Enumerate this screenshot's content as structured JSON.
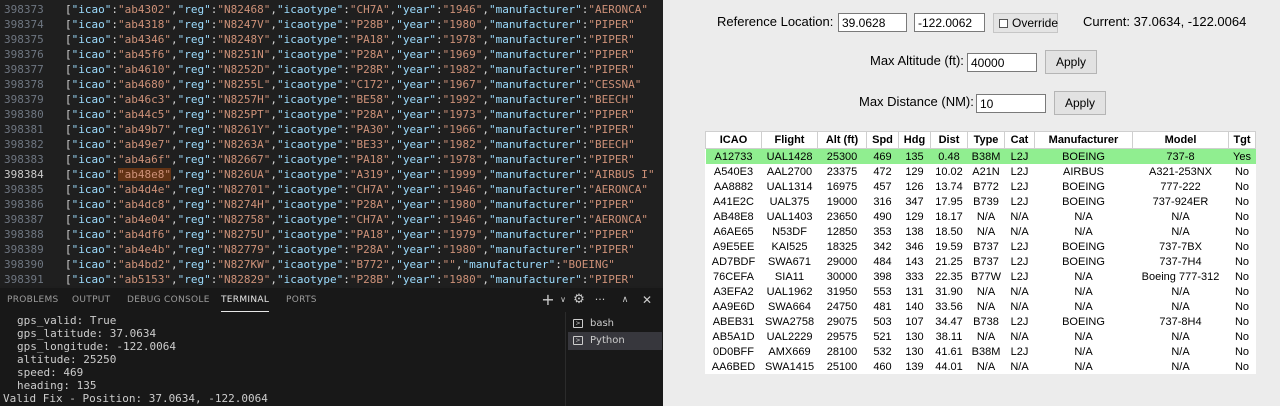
{
  "editor": {
    "lines": [
      {
        "n": "398373",
        "icao": "ab4302",
        "reg": "N82468",
        "icaotype": "CH7A",
        "year": "1946",
        "mfr": "AERONCA"
      },
      {
        "n": "398374",
        "icao": "ab4318",
        "reg": "N8247V",
        "icaotype": "P28B",
        "year": "1980",
        "mfr": "PIPER"
      },
      {
        "n": "398375",
        "icao": "ab4346",
        "reg": "N8248Y",
        "icaotype": "PA18",
        "year": "1978",
        "mfr": "PIPER"
      },
      {
        "n": "398376",
        "icao": "ab45f6",
        "reg": "N8251N",
        "icaotype": "P28A",
        "year": "1969",
        "mfr": "PIPER"
      },
      {
        "n": "398377",
        "icao": "ab4610",
        "reg": "N8252D",
        "icaotype": "P28R",
        "year": "1982",
        "mfr": "PIPER"
      },
      {
        "n": "398378",
        "icao": "ab4680",
        "reg": "N8255L",
        "icaotype": "C172",
        "year": "1967",
        "mfr": "CESSNA"
      },
      {
        "n": "398379",
        "icao": "ab46c3",
        "reg": "N8257H",
        "icaotype": "BE58",
        "year": "1992",
        "mfr": "BEECH"
      },
      {
        "n": "398380",
        "icao": "ab44c5",
        "reg": "N825PT",
        "icaotype": "P28A",
        "year": "1973",
        "mfr": "PIPER"
      },
      {
        "n": "398381",
        "icao": "ab49b7",
        "reg": "N8261Y",
        "icaotype": "PA30",
        "year": "1966",
        "mfr": "PIPER"
      },
      {
        "n": "398382",
        "icao": "ab49e7",
        "reg": "N8263A",
        "icaotype": "BE33",
        "year": "1982",
        "mfr": "BEECH"
      },
      {
        "n": "398383",
        "icao": "ab4a6f",
        "reg": "N82667",
        "icaotype": "PA18",
        "year": "1978",
        "mfr": "PIPER"
      },
      {
        "n": "398384",
        "icao": "ab48e8",
        "reg": "N826UA",
        "icaotype": "A319",
        "year": "1999",
        "mfr": "AIRBUS I"
      },
      {
        "n": "398385",
        "icao": "ab4d4e",
        "reg": "N82701",
        "icaotype": "CH7A",
        "year": "1946",
        "mfr": "AERONCA"
      },
      {
        "n": "398386",
        "icao": "ab4dc8",
        "reg": "N8274H",
        "icaotype": "P28A",
        "year": "1980",
        "mfr": "PIPER"
      },
      {
        "n": "398387",
        "icao": "ab4e04",
        "reg": "N82758",
        "icaotype": "CH7A",
        "year": "1946",
        "mfr": "AERONCA"
      },
      {
        "n": "398388",
        "icao": "ab4df6",
        "reg": "N8275U",
        "icaotype": "PA18",
        "year": "1979",
        "mfr": "PIPER"
      },
      {
        "n": "398389",
        "icao": "ab4e4b",
        "reg": "N82779",
        "icaotype": "P28A",
        "year": "1980",
        "mfr": "PIPER"
      },
      {
        "n": "398390",
        "icao": "ab4bd2",
        "reg": "N827KW",
        "icaotype": "B772",
        "year": "",
        "mfr": "BOEING"
      },
      {
        "n": "398391",
        "icao": "ab5153",
        "reg": "N82829",
        "icaotype": "P28B",
        "year": "1980",
        "mfr": "PIPER"
      }
    ]
  },
  "panel": {
    "tabs": [
      "PROBLEMS",
      "OUTPUT",
      "DEBUG CONSOLE",
      "TERMINAL",
      "PORTS"
    ],
    "active_tab": "TERMINAL"
  },
  "terminal": {
    "lines": [
      "gps_valid: True",
      "gps_latitude: 37.0634",
      "gps_longitude: -122.0064",
      "altitude: 25250",
      "speed: 469",
      "heading: 135",
      "Valid Fix - Position: 37.0634, -122.0064"
    ],
    "sessions": [
      "bash",
      "Python"
    ]
  },
  "app": {
    "ref_label": "Reference Location:",
    "ref_lat": "39.0628",
    "ref_lon": "-122.0062",
    "override_label": "Override",
    "current": "Current: 37.0634, -122.0064",
    "alt_label": "Max Altitude (ft):",
    "alt_value": "40000",
    "dist_label": "Max Distance (NM):",
    "dist_value": "10",
    "apply_label": "Apply",
    "target_color": "#90ee90",
    "table": {
      "headers": [
        "ICAO",
        "Flight",
        "Alt (ft)",
        "Spd",
        "Hdg",
        "Dist",
        "Type",
        "Cat",
        "Manufacturer",
        "Model",
        "Tgt"
      ],
      "rows": [
        [
          "A12733",
          "UAL1428",
          "25300",
          "469",
          "135",
          "0.48",
          "B38M",
          "L2J",
          "BOEING",
          "737-8",
          "Yes"
        ],
        [
          "A540E3",
          "AAL2700",
          "23375",
          "472",
          "129",
          "10.02",
          "A21N",
          "L2J",
          "AIRBUS",
          "A321-253NX",
          "No"
        ],
        [
          "AA8882",
          "UAL1314",
          "16975",
          "457",
          "126",
          "13.74",
          "B772",
          "L2J",
          "BOEING",
          "777-222",
          "No"
        ],
        [
          "A41E2C",
          "UAL375",
          "19000",
          "316",
          "347",
          "17.95",
          "B739",
          "L2J",
          "BOEING",
          "737-924ER",
          "No"
        ],
        [
          "AB48E8",
          "UAL1403",
          "23650",
          "490",
          "129",
          "18.17",
          "N/A",
          "N/A",
          "N/A",
          "N/A",
          "No"
        ],
        [
          "A6AE65",
          "N53DF",
          "12850",
          "353",
          "138",
          "18.50",
          "N/A",
          "N/A",
          "N/A",
          "N/A",
          "No"
        ],
        [
          "A9E5EE",
          "KAI525",
          "18325",
          "342",
          "346",
          "19.59",
          "B737",
          "L2J",
          "BOEING",
          "737-7BX",
          "No"
        ],
        [
          "AD7BDF",
          "SWA671",
          "29000",
          "484",
          "143",
          "21.25",
          "B737",
          "L2J",
          "BOEING",
          "737-7H4",
          "No"
        ],
        [
          "76CEFA",
          "SIA11",
          "30000",
          "398",
          "333",
          "22.35",
          "B77W",
          "L2J",
          "N/A",
          "Boeing 777-312",
          "No"
        ],
        [
          "A3EFA2",
          "UAL1962",
          "31950",
          "553",
          "131",
          "31.90",
          "N/A",
          "N/A",
          "N/A",
          "N/A",
          "No"
        ],
        [
          "AA9E6D",
          "SWA664",
          "24750",
          "481",
          "140",
          "33.56",
          "N/A",
          "N/A",
          "N/A",
          "N/A",
          "No"
        ],
        [
          "ABEB31",
          "SWA2758",
          "29075",
          "503",
          "107",
          "34.47",
          "B738",
          "L2J",
          "BOEING",
          "737-8H4",
          "No"
        ],
        [
          "AB5A1D",
          "UAL2229",
          "29575",
          "521",
          "130",
          "38.11",
          "N/A",
          "N/A",
          "N/A",
          "N/A",
          "No"
        ],
        [
          "0D0BFF",
          "AMX669",
          "28100",
          "532",
          "130",
          "41.61",
          "B38M",
          "L2J",
          "N/A",
          "N/A",
          "No"
        ],
        [
          "AA6BED",
          "SWA1415",
          "25100",
          "460",
          "139",
          "44.01",
          "N/A",
          "N/A",
          "N/A",
          "N/A",
          "No"
        ]
      ]
    }
  }
}
